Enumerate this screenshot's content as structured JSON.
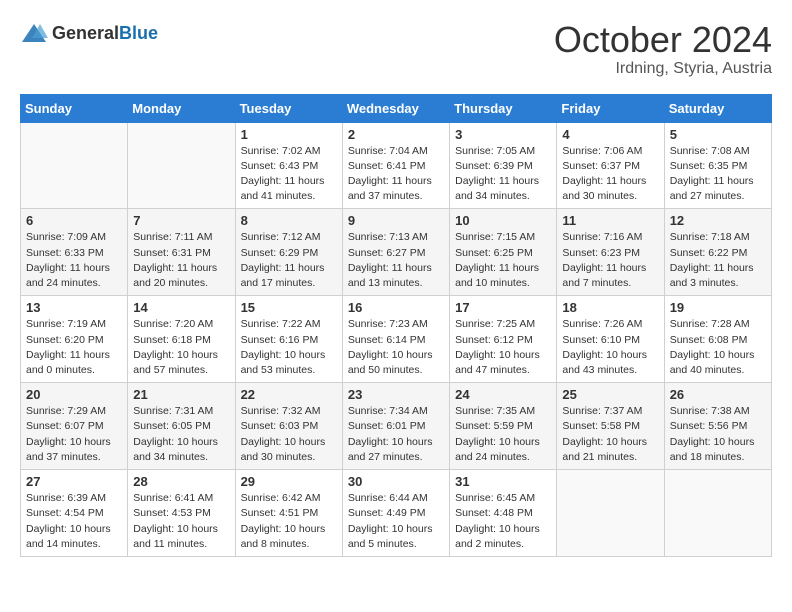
{
  "header": {
    "logo_general": "General",
    "logo_blue": "Blue",
    "month": "October 2024",
    "location": "Irdning, Styria, Austria"
  },
  "days_of_week": [
    "Sunday",
    "Monday",
    "Tuesday",
    "Wednesday",
    "Thursday",
    "Friday",
    "Saturday"
  ],
  "weeks": [
    [
      {
        "day": "",
        "sunrise": "",
        "sunset": "",
        "daylight": ""
      },
      {
        "day": "",
        "sunrise": "",
        "sunset": "",
        "daylight": ""
      },
      {
        "day": "1",
        "sunrise": "Sunrise: 7:02 AM",
        "sunset": "Sunset: 6:43 PM",
        "daylight": "Daylight: 11 hours and 41 minutes."
      },
      {
        "day": "2",
        "sunrise": "Sunrise: 7:04 AM",
        "sunset": "Sunset: 6:41 PM",
        "daylight": "Daylight: 11 hours and 37 minutes."
      },
      {
        "day": "3",
        "sunrise": "Sunrise: 7:05 AM",
        "sunset": "Sunset: 6:39 PM",
        "daylight": "Daylight: 11 hours and 34 minutes."
      },
      {
        "day": "4",
        "sunrise": "Sunrise: 7:06 AM",
        "sunset": "Sunset: 6:37 PM",
        "daylight": "Daylight: 11 hours and 30 minutes."
      },
      {
        "day": "5",
        "sunrise": "Sunrise: 7:08 AM",
        "sunset": "Sunset: 6:35 PM",
        "daylight": "Daylight: 11 hours and 27 minutes."
      }
    ],
    [
      {
        "day": "6",
        "sunrise": "Sunrise: 7:09 AM",
        "sunset": "Sunset: 6:33 PM",
        "daylight": "Daylight: 11 hours and 24 minutes."
      },
      {
        "day": "7",
        "sunrise": "Sunrise: 7:11 AM",
        "sunset": "Sunset: 6:31 PM",
        "daylight": "Daylight: 11 hours and 20 minutes."
      },
      {
        "day": "8",
        "sunrise": "Sunrise: 7:12 AM",
        "sunset": "Sunset: 6:29 PM",
        "daylight": "Daylight: 11 hours and 17 minutes."
      },
      {
        "day": "9",
        "sunrise": "Sunrise: 7:13 AM",
        "sunset": "Sunset: 6:27 PM",
        "daylight": "Daylight: 11 hours and 13 minutes."
      },
      {
        "day": "10",
        "sunrise": "Sunrise: 7:15 AM",
        "sunset": "Sunset: 6:25 PM",
        "daylight": "Daylight: 11 hours and 10 minutes."
      },
      {
        "day": "11",
        "sunrise": "Sunrise: 7:16 AM",
        "sunset": "Sunset: 6:23 PM",
        "daylight": "Daylight: 11 hours and 7 minutes."
      },
      {
        "day": "12",
        "sunrise": "Sunrise: 7:18 AM",
        "sunset": "Sunset: 6:22 PM",
        "daylight": "Daylight: 11 hours and 3 minutes."
      }
    ],
    [
      {
        "day": "13",
        "sunrise": "Sunrise: 7:19 AM",
        "sunset": "Sunset: 6:20 PM",
        "daylight": "Daylight: 11 hours and 0 minutes."
      },
      {
        "day": "14",
        "sunrise": "Sunrise: 7:20 AM",
        "sunset": "Sunset: 6:18 PM",
        "daylight": "Daylight: 10 hours and 57 minutes."
      },
      {
        "day": "15",
        "sunrise": "Sunrise: 7:22 AM",
        "sunset": "Sunset: 6:16 PM",
        "daylight": "Daylight: 10 hours and 53 minutes."
      },
      {
        "day": "16",
        "sunrise": "Sunrise: 7:23 AM",
        "sunset": "Sunset: 6:14 PM",
        "daylight": "Daylight: 10 hours and 50 minutes."
      },
      {
        "day": "17",
        "sunrise": "Sunrise: 7:25 AM",
        "sunset": "Sunset: 6:12 PM",
        "daylight": "Daylight: 10 hours and 47 minutes."
      },
      {
        "day": "18",
        "sunrise": "Sunrise: 7:26 AM",
        "sunset": "Sunset: 6:10 PM",
        "daylight": "Daylight: 10 hours and 43 minutes."
      },
      {
        "day": "19",
        "sunrise": "Sunrise: 7:28 AM",
        "sunset": "Sunset: 6:08 PM",
        "daylight": "Daylight: 10 hours and 40 minutes."
      }
    ],
    [
      {
        "day": "20",
        "sunrise": "Sunrise: 7:29 AM",
        "sunset": "Sunset: 6:07 PM",
        "daylight": "Daylight: 10 hours and 37 minutes."
      },
      {
        "day": "21",
        "sunrise": "Sunrise: 7:31 AM",
        "sunset": "Sunset: 6:05 PM",
        "daylight": "Daylight: 10 hours and 34 minutes."
      },
      {
        "day": "22",
        "sunrise": "Sunrise: 7:32 AM",
        "sunset": "Sunset: 6:03 PM",
        "daylight": "Daylight: 10 hours and 30 minutes."
      },
      {
        "day": "23",
        "sunrise": "Sunrise: 7:34 AM",
        "sunset": "Sunset: 6:01 PM",
        "daylight": "Daylight: 10 hours and 27 minutes."
      },
      {
        "day": "24",
        "sunrise": "Sunrise: 7:35 AM",
        "sunset": "Sunset: 5:59 PM",
        "daylight": "Daylight: 10 hours and 24 minutes."
      },
      {
        "day": "25",
        "sunrise": "Sunrise: 7:37 AM",
        "sunset": "Sunset: 5:58 PM",
        "daylight": "Daylight: 10 hours and 21 minutes."
      },
      {
        "day": "26",
        "sunrise": "Sunrise: 7:38 AM",
        "sunset": "Sunset: 5:56 PM",
        "daylight": "Daylight: 10 hours and 18 minutes."
      }
    ],
    [
      {
        "day": "27",
        "sunrise": "Sunrise: 6:39 AM",
        "sunset": "Sunset: 4:54 PM",
        "daylight": "Daylight: 10 hours and 14 minutes."
      },
      {
        "day": "28",
        "sunrise": "Sunrise: 6:41 AM",
        "sunset": "Sunset: 4:53 PM",
        "daylight": "Daylight: 10 hours and 11 minutes."
      },
      {
        "day": "29",
        "sunrise": "Sunrise: 6:42 AM",
        "sunset": "Sunset: 4:51 PM",
        "daylight": "Daylight: 10 hours and 8 minutes."
      },
      {
        "day": "30",
        "sunrise": "Sunrise: 6:44 AM",
        "sunset": "Sunset: 4:49 PM",
        "daylight": "Daylight: 10 hours and 5 minutes."
      },
      {
        "day": "31",
        "sunrise": "Sunrise: 6:45 AM",
        "sunset": "Sunset: 4:48 PM",
        "daylight": "Daylight: 10 hours and 2 minutes."
      },
      {
        "day": "",
        "sunrise": "",
        "sunset": "",
        "daylight": ""
      },
      {
        "day": "",
        "sunrise": "",
        "sunset": "",
        "daylight": ""
      }
    ]
  ]
}
